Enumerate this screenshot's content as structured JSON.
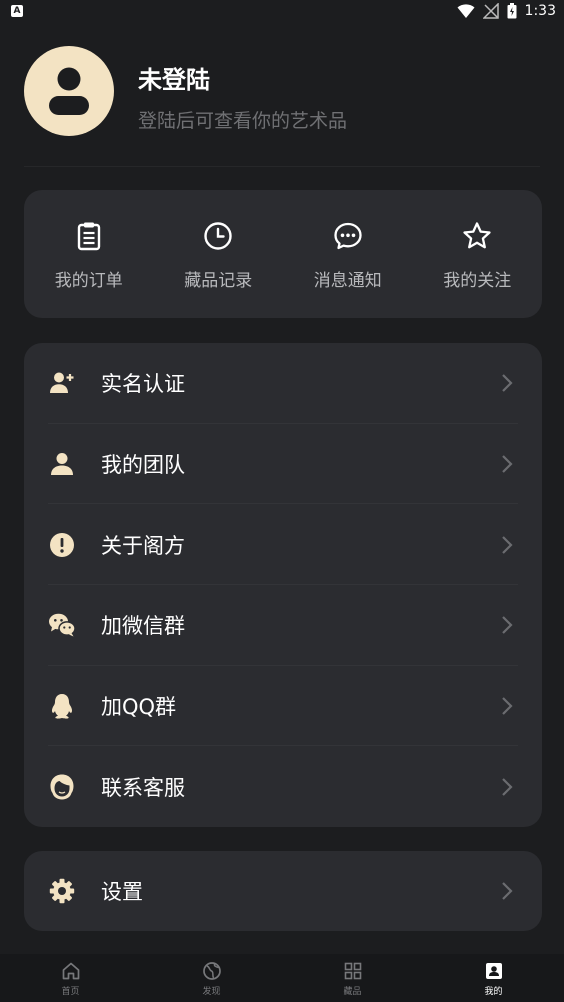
{
  "status_bar": {
    "time": "1:33",
    "left_badge": "A"
  },
  "profile": {
    "title": "未登陆",
    "subtitle": "登陆后可查看你的艺术品"
  },
  "quick_actions": [
    {
      "label": "我的订单",
      "icon": "clipboard-icon"
    },
    {
      "label": "藏品记录",
      "icon": "clock-icon"
    },
    {
      "label": "消息通知",
      "icon": "chat-icon"
    },
    {
      "label": "我的关注",
      "icon": "star-icon"
    }
  ],
  "menu": [
    {
      "label": "实名认证",
      "icon": "user-add-icon"
    },
    {
      "label": "我的团队",
      "icon": "user-icon"
    },
    {
      "label": "关于阁方",
      "icon": "info-icon"
    },
    {
      "label": "加微信群",
      "icon": "wechat-icon"
    },
    {
      "label": "加QQ群",
      "icon": "qq-icon"
    },
    {
      "label": "联系客服",
      "icon": "service-icon"
    }
  ],
  "settings": {
    "label": "设置",
    "icon": "gear-icon"
  },
  "tabs": [
    {
      "label": "首页",
      "icon": "home-icon"
    },
    {
      "label": "发现",
      "icon": "globe-icon"
    },
    {
      "label": "藏品",
      "icon": "grid-icon"
    },
    {
      "label": "我的",
      "icon": "profile-icon",
      "active": true
    }
  ],
  "colors": {
    "accent": "#f3e3c3",
    "card": "#2b2c30",
    "background": "#1c1d1f"
  }
}
